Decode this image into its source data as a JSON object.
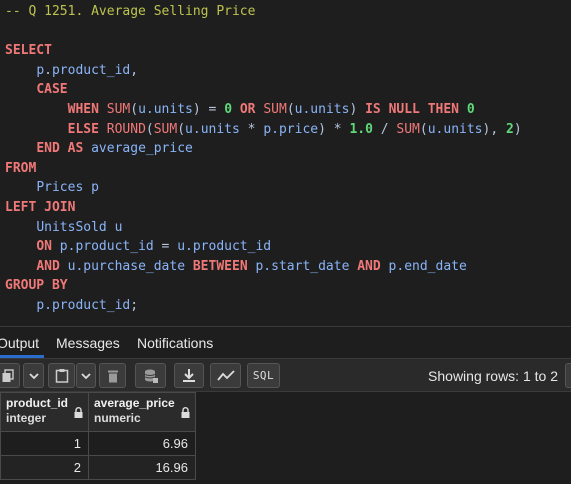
{
  "editor": {
    "lines": [
      "-- Q 1251. Average Selling Price",
      "",
      "SELECT",
      "    p.product_id,",
      "    CASE",
      "        WHEN SUM(u.units) = 0 OR SUM(u.units) IS NULL THEN 0",
      "        ELSE ROUND(SUM(u.units * p.price) * 1.0 / SUM(u.units), 2)",
      "    END AS average_price",
      "FROM",
      "    Prices p",
      "LEFT JOIN",
      "    UnitsSold u",
      "    ON p.product_id = u.product_id",
      "    AND u.purchase_date BETWEEN p.start_date AND p.end_date",
      "GROUP BY",
      "    p.product_id;"
    ]
  },
  "tabs": {
    "output": "Output",
    "messages": "Messages",
    "notifications": "Notifications"
  },
  "toolbar": {
    "icons": [
      "copy-icon",
      "chevron-down-icon",
      "paste-icon",
      "chevron-down-icon",
      "delete-icon",
      "save-data-icon",
      "download-icon",
      "graph-icon",
      "sql-icon"
    ],
    "sql_label": "SQL",
    "showing_rows": "Showing rows: 1 to 2"
  },
  "grid": {
    "columns": [
      {
        "name": "product_id",
        "type": "integer"
      },
      {
        "name": "average_price",
        "type": "numeric"
      }
    ],
    "rows": [
      [
        "1",
        "6.96"
      ],
      [
        "2",
        "16.96"
      ]
    ]
  },
  "colors": {
    "background": "#1e1e1e",
    "keyword": "#f07878",
    "identifier": "#8ab4f8",
    "number": "#5fd97a",
    "comment": "#bcc44f",
    "tab_active_underline": "#2a6dcc"
  }
}
